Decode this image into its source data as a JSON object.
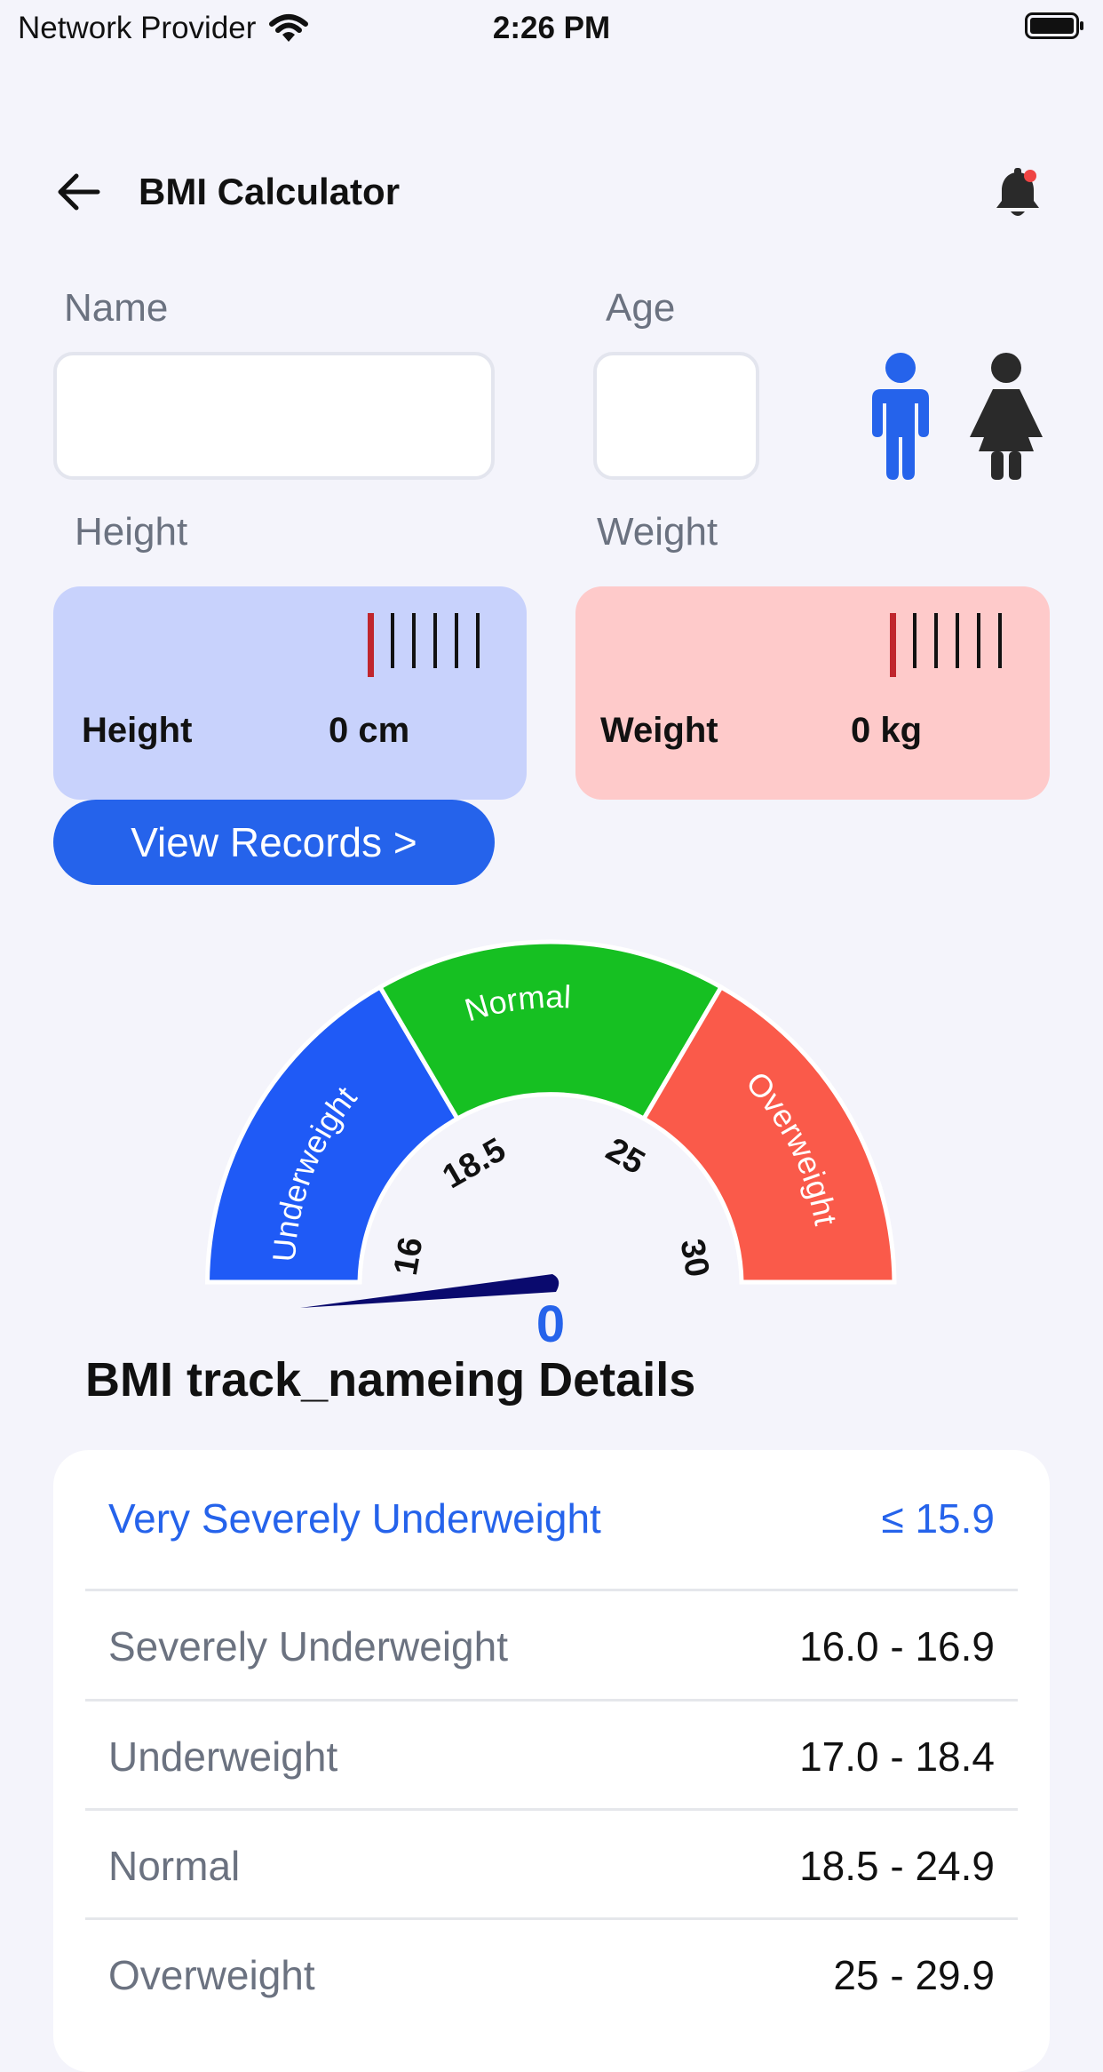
{
  "status_bar": {
    "carrier": "Network Provider",
    "time": "2:26 PM"
  },
  "header": {
    "title": "BMI Calculator"
  },
  "form": {
    "name_label": "Name",
    "name_value": "",
    "age_label": "Age",
    "age_value": "",
    "height_label": "Height",
    "weight_label": "Weight"
  },
  "height_card": {
    "label": "Height",
    "value": "0 cm"
  },
  "weight_card": {
    "label": "Weight",
    "value": "0 kg"
  },
  "view_records_label": "View Records >",
  "gauge": {
    "segments": [
      {
        "label": "Underweight",
        "color": "#1f5af6"
      },
      {
        "label": "Normal",
        "color": "#16c022"
      },
      {
        "label": "Overweight",
        "color": "#fa5a4a"
      }
    ],
    "ticks": [
      "16",
      "18.5",
      "25",
      "30"
    ],
    "value": "0",
    "needle_color": "#0a0a6e"
  },
  "details": {
    "title": "BMI track_nameing Details",
    "rows": [
      {
        "label": "Very Severely Underweight",
        "range": "≤ 15.9",
        "active": true
      },
      {
        "label": "Severely Underweight",
        "range": "16.0 - 16.9"
      },
      {
        "label": "Underweight",
        "range": "17.0 - 18.4"
      },
      {
        "label": "Normal",
        "range": "18.5 - 24.9"
      },
      {
        "label": "Overweight",
        "range": "25 - 29.9"
      }
    ]
  },
  "colors": {
    "accent": "#2563eb",
    "height_card": "#c8d2fc",
    "weight_card": "#fecaca",
    "male_icon": "#2563eb",
    "female_icon": "#2a2a2a"
  }
}
